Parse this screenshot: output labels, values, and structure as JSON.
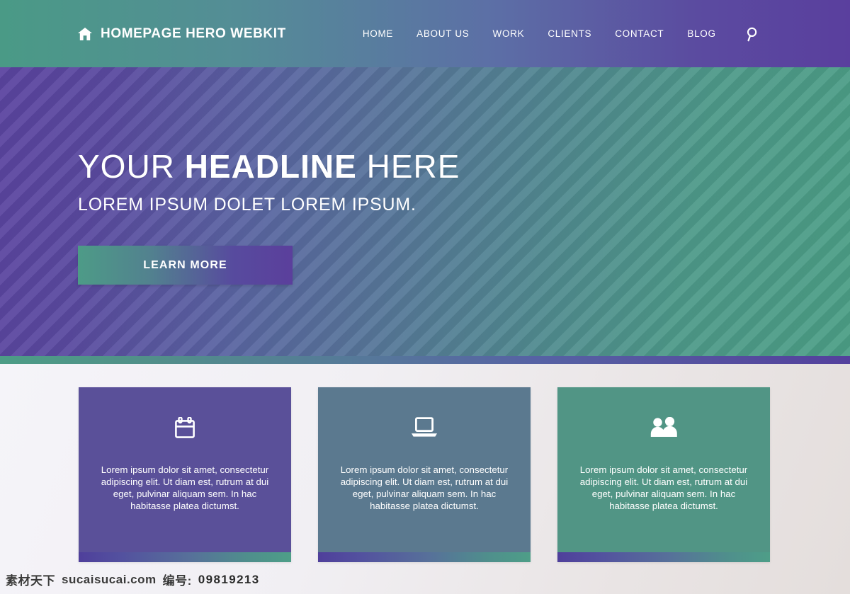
{
  "header": {
    "home_icon": "home-icon",
    "brand_title": "HOMEPAGE HERO WEBKIT",
    "nav": [
      {
        "label": "HOME"
      },
      {
        "label": "ABOUT US"
      },
      {
        "label": "WORK"
      },
      {
        "label": "CLIENTS"
      },
      {
        "label": "CONTACT"
      },
      {
        "label": "BLOG"
      }
    ],
    "search_icon": "search-icon",
    "gradient_from": "#4a9a86",
    "gradient_to": "#5a3f9e"
  },
  "hero": {
    "headline_prefix": "YOUR ",
    "headline_strong": "HEADLINE",
    "headline_suffix": " HERE",
    "subheadline": "LOREM IPSUM DOLET LOREM IPSUM.",
    "cta_label": "LEARN MORE",
    "stripe_angle": "135deg",
    "gradient_from": "#5b44a0",
    "gradient_to": "#4c9f86"
  },
  "divider": {
    "gradient_from": "#4c9c86",
    "gradient_to": "#54409d"
  },
  "cards": [
    {
      "icon": "calendar-icon",
      "background": "#5a5099",
      "text": "Lorem ipsum dolor sit amet, consectetur adipiscing elit. Ut diam est, rutrum at dui eget, pulvinar aliquam sem. In hac habitasse platea dictumst."
    },
    {
      "icon": "laptop-icon",
      "background": "#5b798f",
      "text": "Lorem ipsum dolor sit amet, consectetur adipiscing elit. Ut diam est, rutrum at dui eget, pulvinar aliquam sem. In hac habitasse platea dictumst."
    },
    {
      "icon": "people-icon",
      "background": "#519585",
      "text": "Lorem ipsum dolor sit amet, consectetur adipiscing elit. Ut diam est, rutrum at dui eget, pulvinar aliquam sem. In hac habitasse platea dictumst."
    }
  ],
  "watermark": {
    "site_cn": "素材天下",
    "site_url": "sucaisucai.com",
    "code_label": "编号:",
    "code_value": "09819213"
  }
}
